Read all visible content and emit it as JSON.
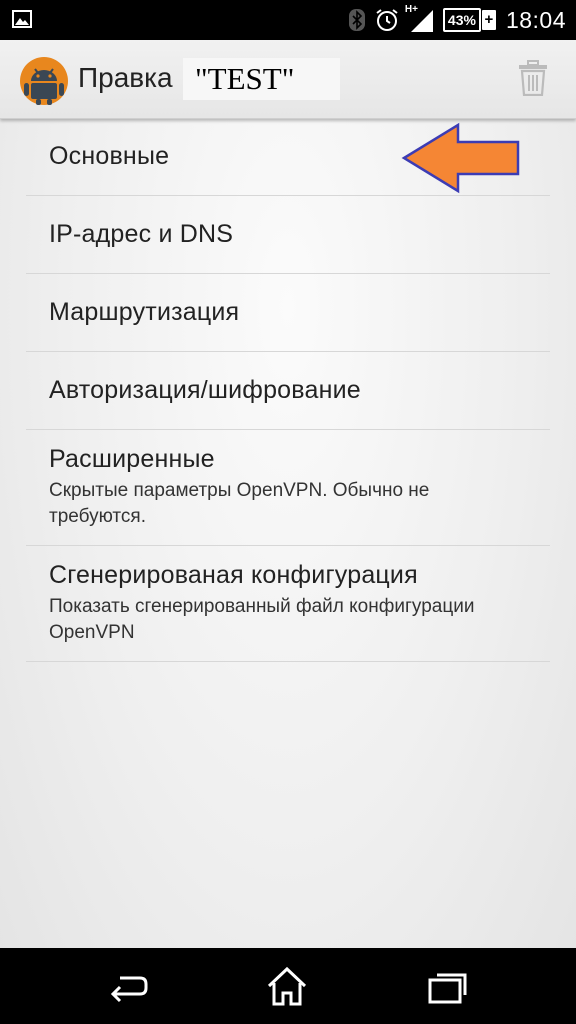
{
  "status_bar": {
    "time": "18:04",
    "battery_percent": "43%",
    "battery_plus": "+",
    "network_type": "H+",
    "icons": [
      "gallery-icon",
      "bluetooth-icon",
      "alarm-icon",
      "signal-icon",
      "battery-icon"
    ]
  },
  "action_bar": {
    "title": "Правка",
    "profile_name": "\"TEST\"",
    "delete_icon": "trash-icon"
  },
  "preferences": [
    {
      "title": "Основные"
    },
    {
      "title": "IP-адрес и DNS"
    },
    {
      "title": "Маршрутизация"
    },
    {
      "title": "Авторизация/шифрование"
    },
    {
      "title": "Расширенные",
      "summary": "Скрытые параметры OpenVPN. Обычно не требуются."
    },
    {
      "title": "Сгенерированая конфигурация",
      "summary": "Показать сгенерированный файл конфигурации OpenVPN"
    }
  ],
  "annotation": {
    "arrow_color": "#f58634",
    "arrow_border": "#3c3cb4"
  },
  "nav_bar": {
    "icons": [
      "back-icon",
      "home-icon",
      "recent-apps-icon"
    ]
  }
}
